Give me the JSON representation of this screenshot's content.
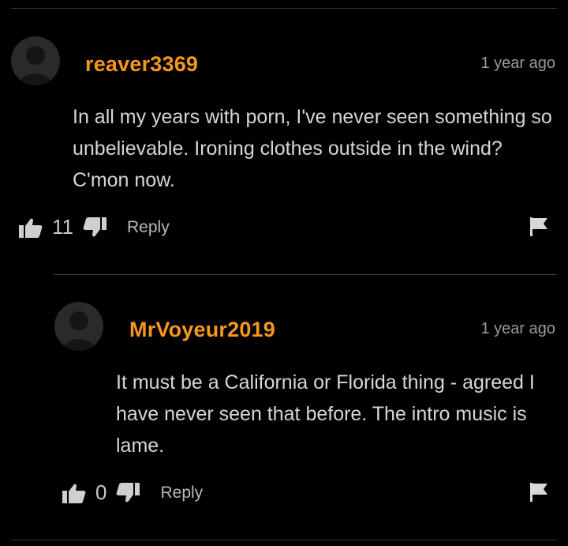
{
  "comments": [
    {
      "username": "reaver3369",
      "time": "1 year ago",
      "text": "In all my years with porn, I've never seen something so unbelievable. Ironing clothes outside in the wind? C'mon now.",
      "likes": "11",
      "reply_label": "Reply",
      "icons": [
        "avatar-icon",
        "thumbs-up-icon",
        "thumbs-down-icon",
        "flag-icon"
      ]
    },
    {
      "username": "MrVoyeur2019",
      "time": "1 year ago",
      "text": "It must be a California or Florida thing - agreed I have never seen that before. The intro music is lame.",
      "likes": "0",
      "reply_label": "Reply",
      "icons": [
        "avatar-icon",
        "thumbs-up-icon",
        "thumbs-down-icon",
        "flag-icon"
      ]
    }
  ],
  "colors": {
    "background": "#000000",
    "username": "#f7971e",
    "text": "#d6d6d6",
    "muted": "#9a9a9a",
    "divider": "#3a3a3a"
  }
}
